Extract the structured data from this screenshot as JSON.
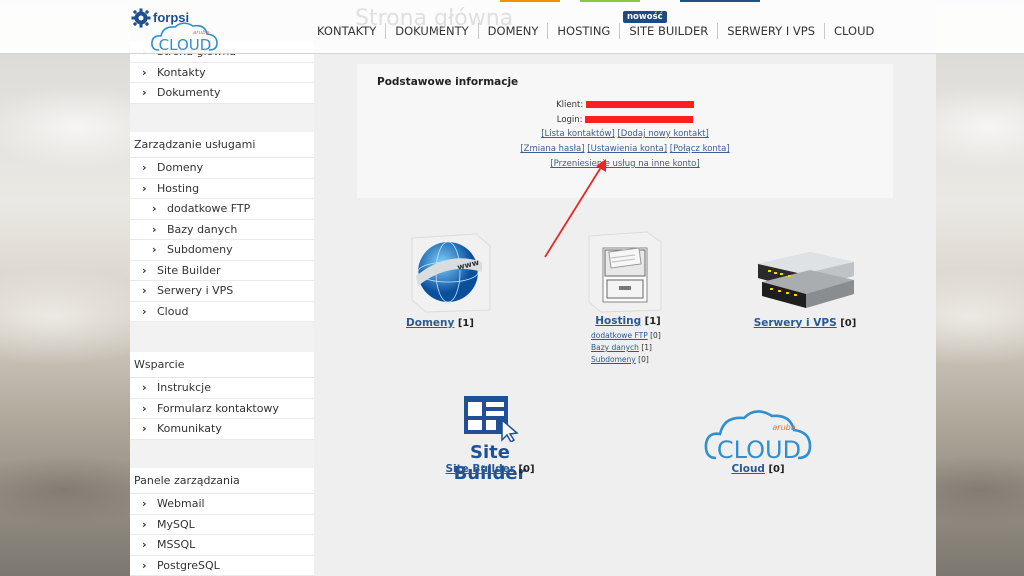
{
  "header": {
    "logo_brand": "forpsi",
    "logo_product": "CLOUD",
    "logo_sub": "aruba",
    "nav": [
      "KONTAKTY",
      "DOKUMENTY",
      "DOMENY",
      "HOSTING",
      "SITE BUILDER",
      "SERWERY I VPS",
      "CLOUD"
    ],
    "badge": "nowość",
    "faded_title": "Strona główna"
  },
  "sidebar": {
    "top_items": [
      "Strona główna",
      "Kontakty",
      "Dokumenty"
    ],
    "services_head": "Zarządzanie usługami",
    "services": [
      {
        "label": "Domeny",
        "sub": false
      },
      {
        "label": "Hosting",
        "sub": false
      },
      {
        "label": "dodatkowe FTP",
        "sub": true
      },
      {
        "label": "Bazy danych",
        "sub": true
      },
      {
        "label": "Subdomeny",
        "sub": true
      },
      {
        "label": "Site Builder",
        "sub": false
      },
      {
        "label": "Serwery i VPS",
        "sub": false
      },
      {
        "label": "Cloud",
        "sub": false
      }
    ],
    "support_head": "Wsparcie",
    "support": [
      "Instrukcje",
      "Formularz kontaktowy",
      "Komunikaty"
    ],
    "panels_head": "Panele zarządzania",
    "panels": [
      "Webmail",
      "MySQL",
      "MSSQL",
      "PostgreSQL"
    ]
  },
  "info": {
    "title": "Podstawowe informacje",
    "client_label": "Klient:",
    "login_label": "Login:",
    "links_row1": [
      "[Lista kontaktów]",
      "[Dodaj nowy kontakt]"
    ],
    "links_row2": [
      "[Zmiana hasła]",
      "[Ustawienia konta]",
      "[Połącz konta]"
    ],
    "links_row3": [
      "[Przeniesienie usług na inne konto]"
    ]
  },
  "tiles": {
    "domeny": {
      "label": "Domeny",
      "count": "[1]",
      "globe_text": "www"
    },
    "hosting": {
      "label": "Hosting",
      "count": "[1]",
      "subs": [
        {
          "label": "dodatkowe FTP",
          "count": "[0]"
        },
        {
          "label": "Bazy danych",
          "count": "[1]"
        },
        {
          "label": "Subdomeny",
          "count": "[0]"
        }
      ]
    },
    "serwery": {
      "label": "Serwery i VPS",
      "count": "[0]"
    },
    "sitebuilder": {
      "label": "Site Builder",
      "count": "[0]",
      "logo_text": "Site Builder"
    },
    "cloud": {
      "label": "Cloud",
      "count": "[0]",
      "logo_text": "CLOUD",
      "logo_sub": "aruba"
    }
  },
  "colors": {
    "brand_blue": "#1d4f91",
    "cloud_blue": "#2f8fd1",
    "link_blue": "#2a5a94",
    "annotation_red": "#e82828"
  }
}
